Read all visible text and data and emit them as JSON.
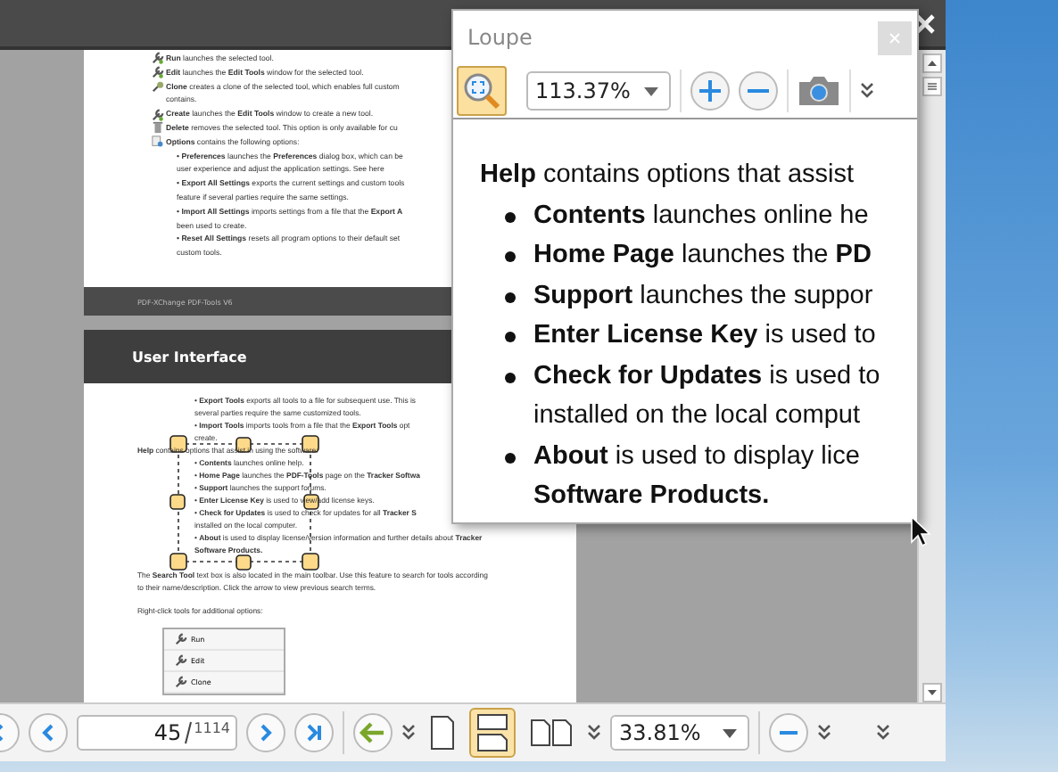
{
  "document": {
    "page_1": {
      "lines": [
        {
          "kind": "tool",
          "text": "**Run** launches the selected tool."
        },
        {
          "kind": "tool",
          "text": "**Edit** launches the **Edit Tools** window for the selected tool."
        },
        {
          "kind": "clone",
          "text": "**Clone** creates a clone of the selected tool, which enables full custom"
        },
        {
          "kind": "text",
          "text": "contains."
        },
        {
          "kind": "tool",
          "text": "**Create** launches the **Edit Tools** window to create a new tool."
        },
        {
          "kind": "delete",
          "text": "**Delete** removes the selected tool. This option is only available for cu"
        },
        {
          "kind": "options",
          "text": "**Options** contains the following options:"
        },
        {
          "kind": "sub",
          "text": "• **Preferences** launches the **Preferences** dialog box, which can be"
        },
        {
          "kind": "sub",
          "text": "user experience and adjust the application settings. See here"
        },
        {
          "kind": "sub",
          "text": "• **Export All Settings** exports the current settings and custom tools"
        },
        {
          "kind": "sub",
          "text": "feature if several parties require the same settings."
        },
        {
          "kind": "sub",
          "text": "• **Import All Settings** imports settings from a file that the **Export A**"
        },
        {
          "kind": "sub",
          "text": "been used to create."
        },
        {
          "kind": "sub",
          "text": "• **Reset All Settings** resets all program options to their default set"
        },
        {
          "kind": "sub",
          "text": "custom tools."
        }
      ],
      "footer": "PDF-XChange PDF-Tools V6"
    },
    "page_2": {
      "header": "User Interface",
      "lines": [
        {
          "kind": "sub",
          "text": "• **Export Tools** exports all tools to a file for subsequent use. This is"
        },
        {
          "kind": "sub",
          "text": "several parties require the same customized tools."
        },
        {
          "kind": "sub",
          "text": "• **Import Tools** imports tools from a file that the **Export Tools** opt"
        },
        {
          "kind": "sub",
          "text": "create."
        },
        {
          "kind": "text",
          "text": "**Help** contains options that assist in using the software:"
        },
        {
          "kind": "sub",
          "text": "• **Contents** launches online help."
        },
        {
          "kind": "sub",
          "text": "• **Home Page** launches the **PDF-Tools** page on the **Tracker Softwa**"
        },
        {
          "kind": "sub",
          "text": "• **Support** launches the support forums."
        },
        {
          "kind": "sub",
          "text": "• **Enter License Key** is used to view/add license keys."
        },
        {
          "kind": "sub",
          "text": "• **Check for Updates** is used to check for updates for all **Tracker S**"
        },
        {
          "kind": "sub",
          "text": "installed on the local computer."
        },
        {
          "kind": "sub",
          "text": "• **About** is used to display license/version information and further details about **Tracker**"
        },
        {
          "kind": "sub",
          "text": "**Software Products.**"
        }
      ],
      "paragraphs": [
        "The **Search Tool** text box is also located in the main toolbar. Use this feature to search for tools according to their name/description. Click the arrow to view previous search terms.",
        "Right-click tools for additional options:"
      ],
      "menu_items": [
        "Run",
        "Edit",
        "Clone"
      ]
    }
  },
  "loupe": {
    "title": "Loupe",
    "tool_selected": true,
    "zoom": "113.37%",
    "lead": "**Help** contains options that assist",
    "bullets": [
      {
        "text": "**Contents** launches online he"
      },
      {
        "text": "**Home Page** launches the **PD**"
      },
      {
        "text": "**Support** launches the suppor"
      },
      {
        "text": "**Enter License Key** is used to"
      },
      {
        "text": "**Check for Updates** is used to",
        "continued": "installed on the local comput"
      },
      {
        "text": "**About** is used to display lice",
        "continued": "**Software Products.**"
      }
    ]
  },
  "toolbar": {
    "page_current": "45",
    "page_total": "1114",
    "zoom": "33.81%",
    "view_modes": [
      {
        "kind": "single",
        "selected": false
      },
      {
        "kind": "continuous",
        "selected": true
      },
      {
        "kind": "facing",
        "selected": false
      }
    ]
  }
}
